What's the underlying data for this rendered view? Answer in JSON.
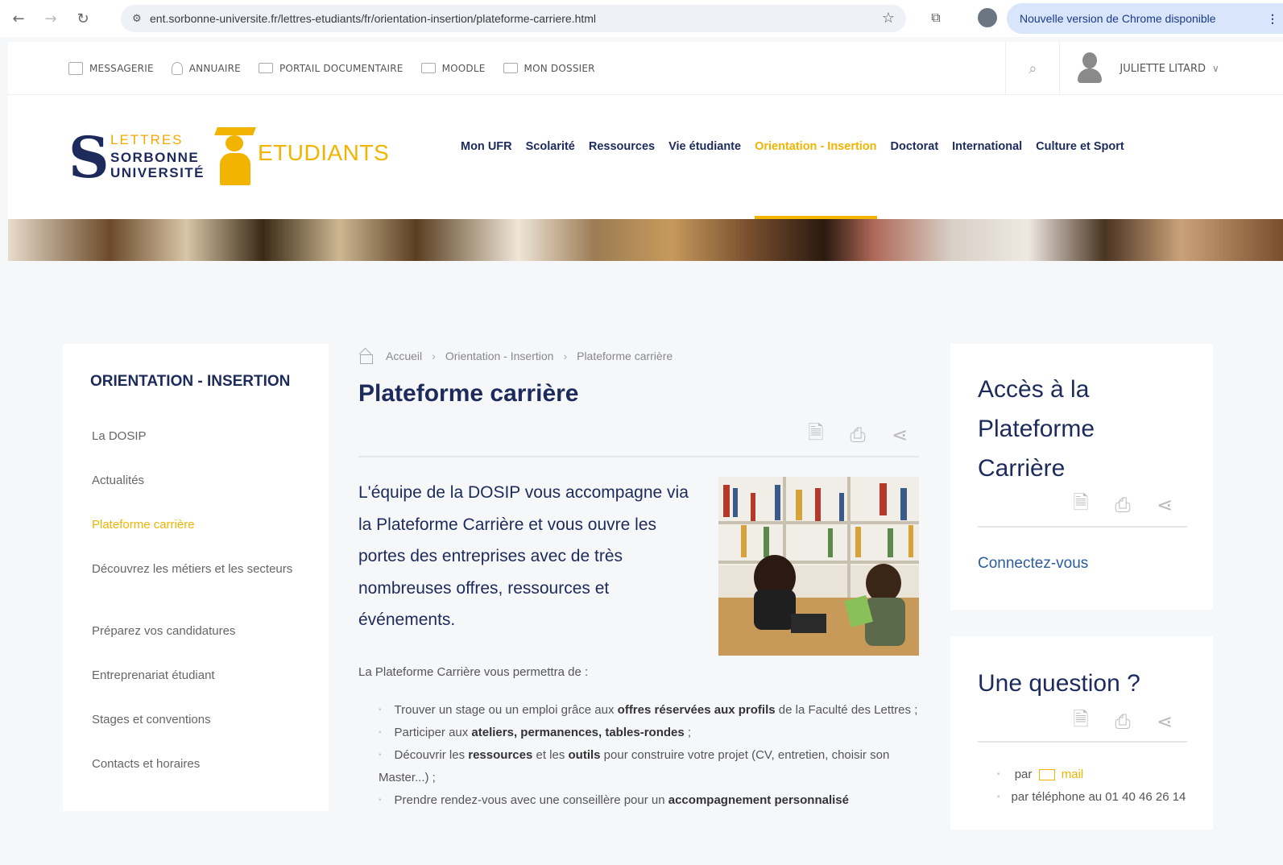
{
  "browser": {
    "url": "ent.sorbonne-universite.fr/lettres-etudiants/fr/orientation-insertion/plateforme-carriere.html",
    "update_label": "Nouvelle version de Chrome disponible",
    "icons": [
      "back-arrow-icon",
      "forward-arrow-icon",
      "reload-icon",
      "site-settings-icon",
      "bookmark-star-icon",
      "extension-icon",
      "profile-icon",
      "menu-dots-icon"
    ]
  },
  "utility": {
    "items": [
      {
        "label": "MESSAGERIE",
        "icon": "calendar-icon"
      },
      {
        "label": "ANNUAIRE",
        "icon": "user-icon"
      },
      {
        "label": "PORTAIL DOCUMENTAIRE",
        "icon": "folder-icon"
      },
      {
        "label": "MOODLE",
        "icon": "folder-icon"
      },
      {
        "label": "MON DOSSIER",
        "icon": "folder-icon"
      }
    ],
    "user_name": "JULIETTE LITARD"
  },
  "logo": {
    "line1": "LETTRES",
    "line2": "SORBONNE",
    "line3": "UNIVERSITÉ",
    "etudiants": "ETUDIANTS"
  },
  "nav": {
    "items": [
      {
        "label": "Mon UFR",
        "active": false
      },
      {
        "label": "Scolarité",
        "active": false
      },
      {
        "label": "Ressources",
        "active": false
      },
      {
        "label": "Vie étudiante",
        "active": false
      },
      {
        "label": "Orientation - Insertion",
        "active": true
      },
      {
        "label": "Doctorat",
        "active": false
      },
      {
        "label": "International",
        "active": false
      },
      {
        "label": "Culture et Sport",
        "active": false
      }
    ]
  },
  "sidebar": {
    "title": "ORIENTATION - INSERTION",
    "items": [
      {
        "label": "La DOSIP",
        "active": false
      },
      {
        "label": "Actualités",
        "active": false
      },
      {
        "label": "Plateforme carrière",
        "active": true
      },
      {
        "label": "Découvrez les métiers et les secteurs",
        "active": false
      },
      {
        "label": "Préparez vos candidatures",
        "active": false
      },
      {
        "label": "Entreprenariat étudiant",
        "active": false
      },
      {
        "label": "Stages et conventions",
        "active": false
      },
      {
        "label": "Contacts et horaires",
        "active": false
      }
    ]
  },
  "breadcrumb": [
    "Accueil",
    "Orientation - Insertion",
    "Plateforme carrière"
  ],
  "main": {
    "title": "Plateforme carrière",
    "lead": "L'équipe de la DOSIP vous accompagne via la Plateforme Carrière et vous ouvre les portes des entreprises avec de très nombreuses offres, ressources et événements.",
    "intro": "La Plateforme Carrière vous permettra de :",
    "bullets": [
      {
        "a": "Trouver un stage ou un emploi grâce aux ",
        "b": "offres réservées aux profils",
        "c": " de la Faculté des Lettres ;"
      },
      {
        "a": "Participer aux ",
        "b": "ateliers, permanences, tables-rondes",
        "c": " ;"
      },
      {
        "a": "Découvrir les ",
        "b": "ressources",
        "c": " et les ",
        "b2": "outils",
        "c2": " pour construire votre projet (CV, entretien, choisir son Master...) ;"
      },
      {
        "a": "Prendre rendez-vous avec une conseillère pour un ",
        "b": "accompagnement personnalisé",
        "c": ""
      }
    ]
  },
  "cards": {
    "access": {
      "title": "Accès à la Plateforme Carrière",
      "link": "Connectez-vous"
    },
    "question": {
      "title": "Une question ?",
      "mail_prefix": "par",
      "mail_label": "mail",
      "phone": "par téléphone au 01 40 46 26 14"
    }
  },
  "colors": {
    "navy": "#1d2a5c",
    "accent": "#f2b400",
    "link": "#2d5c9c"
  }
}
